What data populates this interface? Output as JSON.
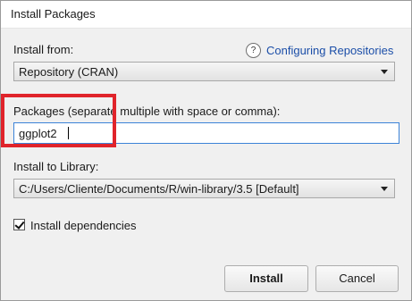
{
  "window": {
    "title": "Install Packages"
  },
  "install_from": {
    "label": "Install from:",
    "help_icon_glyph": "?",
    "help_link": "Configuring Repositories",
    "selected": "Repository (CRAN)"
  },
  "packages": {
    "label": "Packages (separate multiple with space or comma):",
    "value": "ggplot2"
  },
  "library": {
    "label": "Install to Library:",
    "selected": "C:/Users/Cliente/Documents/R/win-library/3.5 [Default]"
  },
  "dependencies": {
    "label": "Install dependencies",
    "checked": true
  },
  "buttons": {
    "install": "Install",
    "cancel": "Cancel"
  },
  "colors": {
    "highlight": "#e0242b",
    "link": "#1b4ea8",
    "focus_border": "#3c83d8"
  }
}
